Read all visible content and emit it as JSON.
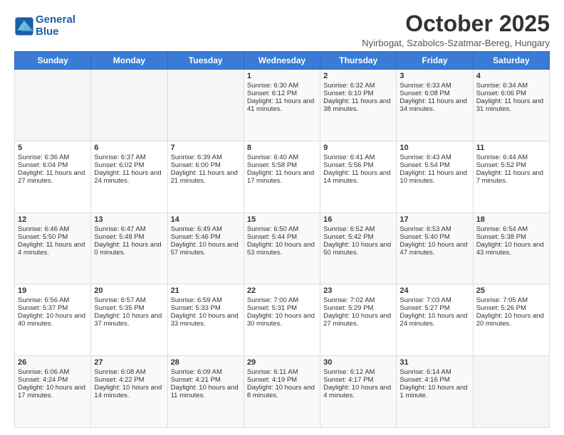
{
  "logo": {
    "line1": "General",
    "line2": "Blue"
  },
  "title": "October 2025",
  "subtitle": "Nyirbogat, Szabolcs-Szatmar-Bereg, Hungary",
  "days_of_week": [
    "Sunday",
    "Monday",
    "Tuesday",
    "Wednesday",
    "Thursday",
    "Friday",
    "Saturday"
  ],
  "weeks": [
    [
      {
        "day": "",
        "info": ""
      },
      {
        "day": "",
        "info": ""
      },
      {
        "day": "",
        "info": ""
      },
      {
        "day": "1",
        "info": "Sunrise: 6:30 AM\nSunset: 6:12 PM\nDaylight: 11 hours and 41 minutes."
      },
      {
        "day": "2",
        "info": "Sunrise: 6:32 AM\nSunset: 6:10 PM\nDaylight: 11 hours and 38 minutes."
      },
      {
        "day": "3",
        "info": "Sunrise: 6:33 AM\nSunset: 6:08 PM\nDaylight: 11 hours and 34 minutes."
      },
      {
        "day": "4",
        "info": "Sunrise: 6:34 AM\nSunset: 6:06 PM\nDaylight: 11 hours and 31 minutes."
      }
    ],
    [
      {
        "day": "5",
        "info": "Sunrise: 6:36 AM\nSunset: 6:04 PM\nDaylight: 11 hours and 27 minutes."
      },
      {
        "day": "6",
        "info": "Sunrise: 6:37 AM\nSunset: 6:02 PM\nDaylight: 11 hours and 24 minutes."
      },
      {
        "day": "7",
        "info": "Sunrise: 6:39 AM\nSunset: 6:00 PM\nDaylight: 11 hours and 21 minutes."
      },
      {
        "day": "8",
        "info": "Sunrise: 6:40 AM\nSunset: 5:58 PM\nDaylight: 11 hours and 17 minutes."
      },
      {
        "day": "9",
        "info": "Sunrise: 6:41 AM\nSunset: 5:56 PM\nDaylight: 11 hours and 14 minutes."
      },
      {
        "day": "10",
        "info": "Sunrise: 6:43 AM\nSunset: 5:54 PM\nDaylight: 11 hours and 10 minutes."
      },
      {
        "day": "11",
        "info": "Sunrise: 6:44 AM\nSunset: 5:52 PM\nDaylight: 11 hours and 7 minutes."
      }
    ],
    [
      {
        "day": "12",
        "info": "Sunrise: 6:46 AM\nSunset: 5:50 PM\nDaylight: 11 hours and 4 minutes."
      },
      {
        "day": "13",
        "info": "Sunrise: 6:47 AM\nSunset: 5:48 PM\nDaylight: 11 hours and 0 minutes."
      },
      {
        "day": "14",
        "info": "Sunrise: 6:49 AM\nSunset: 5:46 PM\nDaylight: 10 hours and 57 minutes."
      },
      {
        "day": "15",
        "info": "Sunrise: 6:50 AM\nSunset: 5:44 PM\nDaylight: 10 hours and 53 minutes."
      },
      {
        "day": "16",
        "info": "Sunrise: 6:52 AM\nSunset: 5:42 PM\nDaylight: 10 hours and 50 minutes."
      },
      {
        "day": "17",
        "info": "Sunrise: 6:53 AM\nSunset: 5:40 PM\nDaylight: 10 hours and 47 minutes."
      },
      {
        "day": "18",
        "info": "Sunrise: 6:54 AM\nSunset: 5:38 PM\nDaylight: 10 hours and 43 minutes."
      }
    ],
    [
      {
        "day": "19",
        "info": "Sunrise: 6:56 AM\nSunset: 5:37 PM\nDaylight: 10 hours and 40 minutes."
      },
      {
        "day": "20",
        "info": "Sunrise: 6:57 AM\nSunset: 5:35 PM\nDaylight: 10 hours and 37 minutes."
      },
      {
        "day": "21",
        "info": "Sunrise: 6:59 AM\nSunset: 5:33 PM\nDaylight: 10 hours and 33 minutes."
      },
      {
        "day": "22",
        "info": "Sunrise: 7:00 AM\nSunset: 5:31 PM\nDaylight: 10 hours and 30 minutes."
      },
      {
        "day": "23",
        "info": "Sunrise: 7:02 AM\nSunset: 5:29 PM\nDaylight: 10 hours and 27 minutes."
      },
      {
        "day": "24",
        "info": "Sunrise: 7:03 AM\nSunset: 5:27 PM\nDaylight: 10 hours and 24 minutes."
      },
      {
        "day": "25",
        "info": "Sunrise: 7:05 AM\nSunset: 5:26 PM\nDaylight: 10 hours and 20 minutes."
      }
    ],
    [
      {
        "day": "26",
        "info": "Sunrise: 6:06 AM\nSunset: 4:24 PM\nDaylight: 10 hours and 17 minutes."
      },
      {
        "day": "27",
        "info": "Sunrise: 6:08 AM\nSunset: 4:22 PM\nDaylight: 10 hours and 14 minutes."
      },
      {
        "day": "28",
        "info": "Sunrise: 6:09 AM\nSunset: 4:21 PM\nDaylight: 10 hours and 11 minutes."
      },
      {
        "day": "29",
        "info": "Sunrise: 6:11 AM\nSunset: 4:19 PM\nDaylight: 10 hours and 8 minutes."
      },
      {
        "day": "30",
        "info": "Sunrise: 6:12 AM\nSunset: 4:17 PM\nDaylight: 10 hours and 4 minutes."
      },
      {
        "day": "31",
        "info": "Sunrise: 6:14 AM\nSunset: 4:16 PM\nDaylight: 10 hours and 1 minute."
      },
      {
        "day": "",
        "info": ""
      }
    ]
  ]
}
